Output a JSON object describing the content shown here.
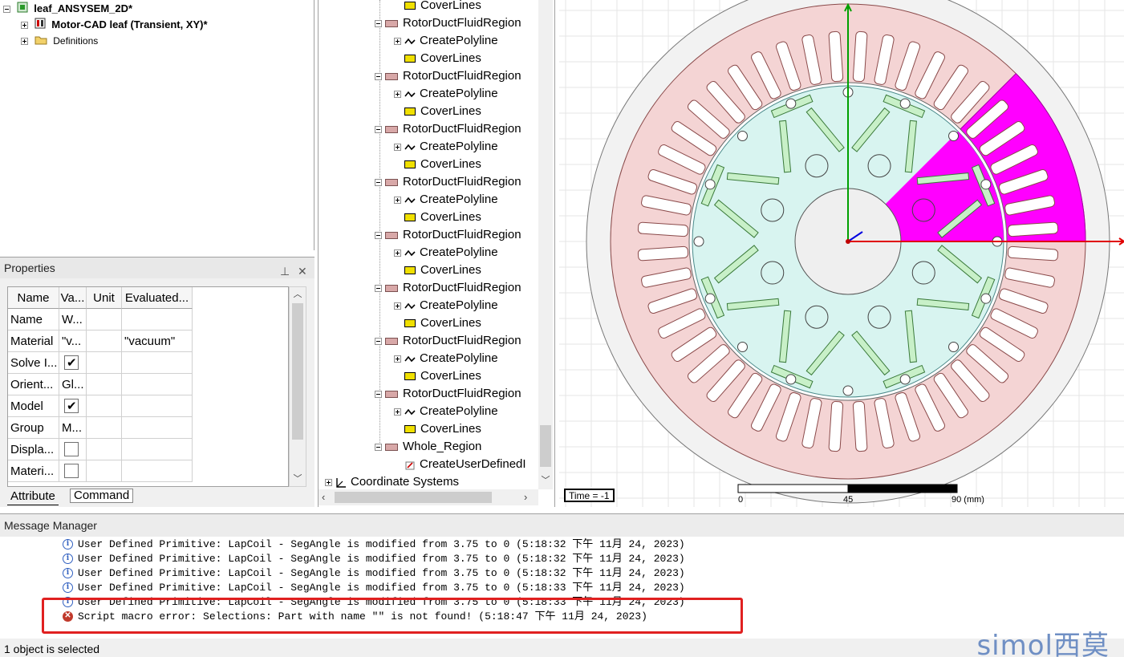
{
  "project_tree": {
    "root": "leaf_ANSYSEM_2D*",
    "design": "Motor-CAD leaf (Transient, XY)*",
    "definitions": "Definitions"
  },
  "properties": {
    "title": "Properties",
    "pin_icon": "pin-icon",
    "close_icon": "close-icon",
    "columns": [
      "Name",
      "Va...",
      "Unit",
      "Evaluated..."
    ],
    "rows": [
      {
        "name": "Name",
        "value": "W...",
        "unit": "",
        "evaluated": "",
        "check": null
      },
      {
        "name": "Material",
        "value": "\"v...",
        "unit": "",
        "evaluated": "\"vacuum\"",
        "check": null
      },
      {
        "name": "Solve I...",
        "value": "",
        "unit": "",
        "evaluated": "",
        "check": true
      },
      {
        "name": "Orient...",
        "value": "Gl...",
        "unit": "",
        "evaluated": "",
        "check": null
      },
      {
        "name": "Model",
        "value": "",
        "unit": "",
        "evaluated": "",
        "check": true
      },
      {
        "name": "Group",
        "value": "M...",
        "unit": "",
        "evaluated": "",
        "check": null
      },
      {
        "name": "Displa...",
        "value": "",
        "unit": "",
        "evaluated": "",
        "check": false
      },
      {
        "name": "Materi...",
        "value": "",
        "unit": "",
        "evaluated": "",
        "check": false
      }
    ],
    "tabs": [
      "Attribute",
      "Command"
    ]
  },
  "model_tree": {
    "items": [
      {
        "level": 2,
        "type": "cover",
        "label": "CoverLines"
      },
      {
        "level": 1,
        "type": "region",
        "label": "RotorDuctFluidRegion"
      },
      {
        "level": 2,
        "type": "poly",
        "label": "CreatePolyline"
      },
      {
        "level": 2,
        "type": "cover",
        "label": "CoverLines"
      },
      {
        "level": 1,
        "type": "region",
        "label": "RotorDuctFluidRegion"
      },
      {
        "level": 2,
        "type": "poly",
        "label": "CreatePolyline"
      },
      {
        "level": 2,
        "type": "cover",
        "label": "CoverLines"
      },
      {
        "level": 1,
        "type": "region",
        "label": "RotorDuctFluidRegion"
      },
      {
        "level": 2,
        "type": "poly",
        "label": "CreatePolyline"
      },
      {
        "level": 2,
        "type": "cover",
        "label": "CoverLines"
      },
      {
        "level": 1,
        "type": "region",
        "label": "RotorDuctFluidRegion"
      },
      {
        "level": 2,
        "type": "poly",
        "label": "CreatePolyline"
      },
      {
        "level": 2,
        "type": "cover",
        "label": "CoverLines"
      },
      {
        "level": 1,
        "type": "region",
        "label": "RotorDuctFluidRegion"
      },
      {
        "level": 2,
        "type": "poly",
        "label": "CreatePolyline"
      },
      {
        "level": 2,
        "type": "cover",
        "label": "CoverLines"
      },
      {
        "level": 1,
        "type": "region",
        "label": "RotorDuctFluidRegion"
      },
      {
        "level": 2,
        "type": "poly",
        "label": "CreatePolyline"
      },
      {
        "level": 2,
        "type": "cover",
        "label": "CoverLines"
      },
      {
        "level": 1,
        "type": "region",
        "label": "RotorDuctFluidRegion"
      },
      {
        "level": 2,
        "type": "poly",
        "label": "CreatePolyline"
      },
      {
        "level": 2,
        "type": "cover",
        "label": "CoverLines"
      },
      {
        "level": 1,
        "type": "region",
        "label": "RotorDuctFluidRegion"
      },
      {
        "level": 2,
        "type": "poly",
        "label": "CreatePolyline"
      },
      {
        "level": 2,
        "type": "cover",
        "label": "CoverLines"
      },
      {
        "level": 1,
        "type": "region",
        "label": "Whole_Region"
      },
      {
        "level": 2,
        "type": "udp",
        "label": "CreateUserDefinedI"
      },
      {
        "level": 0,
        "type": "coord",
        "label": "Coordinate Systems"
      }
    ]
  },
  "viewer": {
    "time_label": "Time = -1",
    "scale": {
      "labels": [
        "0",
        "45",
        "90 (mm)"
      ]
    },
    "axis_colors": {
      "x": "#e00000",
      "y": "#00a000",
      "z": "#0000e0"
    },
    "colors": {
      "stator": "#f4d4d4",
      "rotor": "#d8f4f0",
      "selection": "#ff00ff",
      "magnet": "#c8f0c8"
    }
  },
  "messages": {
    "title": "Message Manager",
    "lines": [
      {
        "type": "info",
        "text": "User Defined Primitive: LapCoil - SegAngle is modified from 3.75 to 0 (5:18:32 下午  11月 24, 2023)"
      },
      {
        "type": "info",
        "text": "User Defined Primitive: LapCoil - SegAngle is modified from 3.75 to 0 (5:18:32 下午  11月 24, 2023)"
      },
      {
        "type": "info",
        "text": "User Defined Primitive: LapCoil - SegAngle is modified from 3.75 to 0 (5:18:32 下午  11月 24, 2023)"
      },
      {
        "type": "info",
        "text": "User Defined Primitive: LapCoil - SegAngle is modified from 3.75 to 0 (5:18:33 下午  11月 24, 2023)"
      },
      {
        "type": "info",
        "text": "User Defined Primitive: LapCoil - SegAngle is modified from 3.75 to 0 (5:18:33 下午  11月 24, 2023)"
      },
      {
        "type": "error",
        "text": "Script macro error: Selections: Part with name \"\" is not found!  (5:18:47 下午  11月 24, 2023)"
      }
    ]
  },
  "status": {
    "text": "1 object is selected"
  },
  "watermark": "simol西莫"
}
